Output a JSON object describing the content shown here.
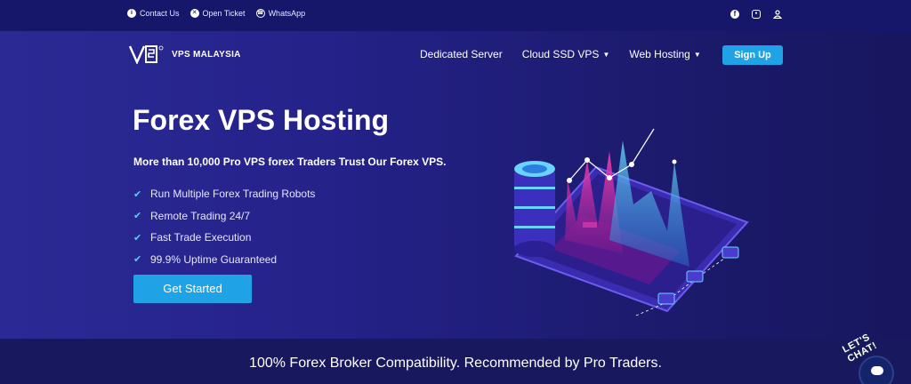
{
  "topbar": {
    "links": [
      {
        "label": "Contact Us",
        "icon": "info-icon"
      },
      {
        "label": "Open Ticket",
        "icon": "ticket-icon"
      },
      {
        "label": "WhatsApp",
        "icon": "whatsapp-icon"
      }
    ],
    "social": [
      "facebook-icon",
      "instagram-icon",
      "user-icon"
    ]
  },
  "header": {
    "brand": "VPS MALAYSIA",
    "nav": [
      {
        "label": "Dedicated Server",
        "dropdown": false
      },
      {
        "label": "Cloud SSD VPS",
        "dropdown": true
      },
      {
        "label": "Web Hosting",
        "dropdown": true
      }
    ],
    "signup_label": "Sign Up"
  },
  "hero": {
    "title": "Forex VPS Hosting",
    "subtitle": "More than 10,000 Pro VPS forex Traders Trust Our Forex VPS.",
    "features": [
      "Run Multiple Forex Trading Robots",
      "Remote Trading 24/7",
      "Fast Trade Execution",
      "99.9% Uptime Guaranteed"
    ],
    "cta_label": "Get Started"
  },
  "band": {
    "text": "100% Forex Broker Compatibility. Recommended by Pro Traders."
  },
  "chat": {
    "label": "LET'S CHAT!"
  },
  "colors": {
    "accent": "#1fa3e6",
    "hero_bg": "#25228a",
    "band_bg": "#18185e",
    "check": "#5ecbf5"
  }
}
